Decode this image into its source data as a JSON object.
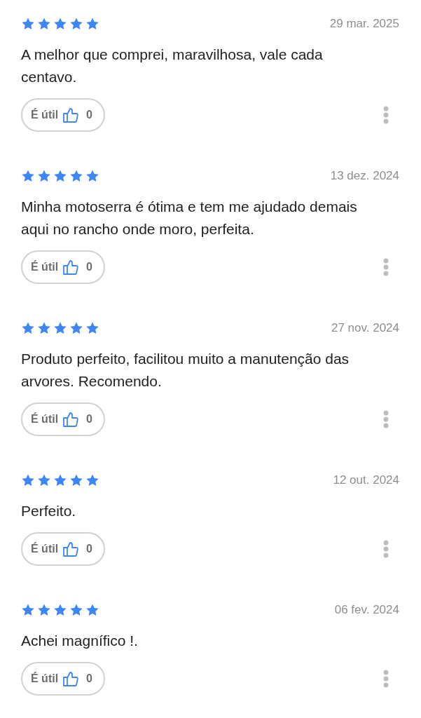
{
  "reviews": [
    {
      "stars": 5,
      "date": "29 mar. 2025",
      "text": "A melhor que comprei, maravilhosa, vale cada centavo.",
      "helpful_label": "É útil",
      "helpful_count": "0"
    },
    {
      "stars": 5,
      "date": "13 dez. 2024",
      "text": "Minha motoserra é ótima e tem me ajudado demais aqui no rancho onde moro, perfeita.",
      "helpful_label": "É útil",
      "helpful_count": "0"
    },
    {
      "stars": 5,
      "date": "27 nov. 2024",
      "text": "Produto perfeito, facilitou muito a manutenção das arvores. Recomendo.",
      "helpful_label": "É útil",
      "helpful_count": "0"
    },
    {
      "stars": 5,
      "date": "12 out. 2024",
      "text": "Perfeito.",
      "helpful_label": "É útil",
      "helpful_count": "0"
    },
    {
      "stars": 5,
      "date": "06 fev. 2024",
      "text": "Achei magnífico !.",
      "helpful_label": "É útil",
      "helpful_count": "0"
    }
  ]
}
